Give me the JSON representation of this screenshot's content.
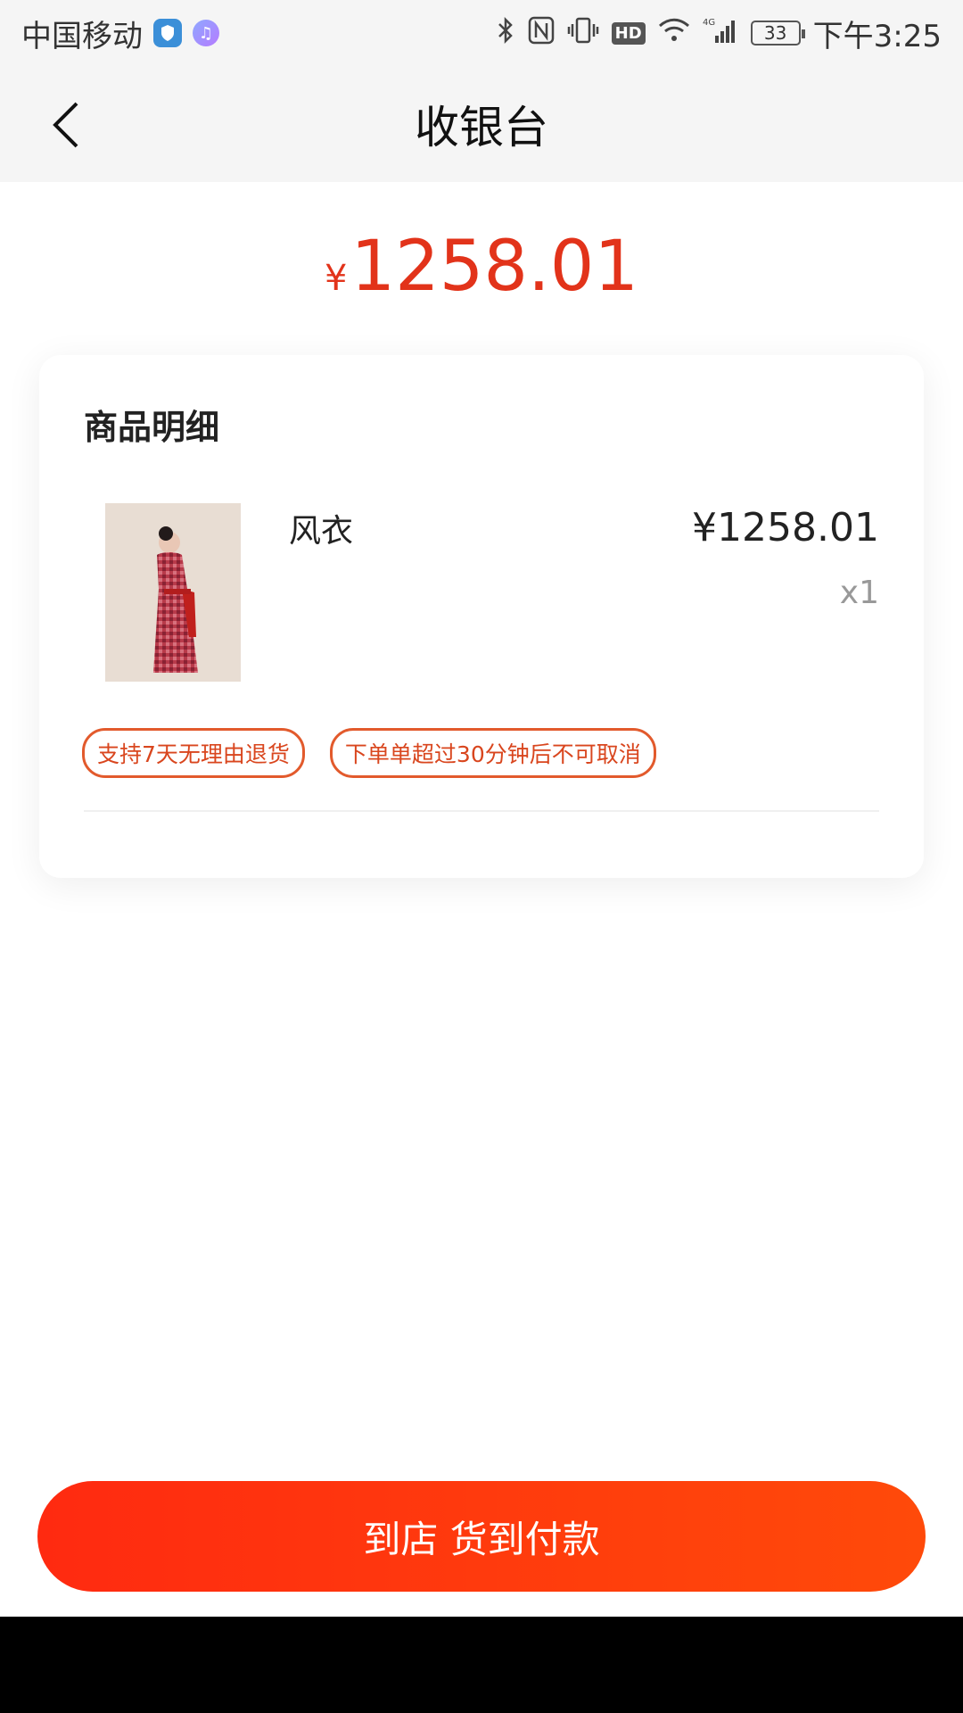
{
  "status_bar": {
    "carrier": "中国移动",
    "battery": "33",
    "time": "下午3:25",
    "network": "4G",
    "hd": "HD"
  },
  "nav": {
    "title": "收银台"
  },
  "amount": {
    "symbol": "¥",
    "value": "1258.01"
  },
  "card": {
    "title": "商品明细",
    "product": {
      "name": "风衣",
      "price": "¥1258.01",
      "qty": "x1"
    },
    "tags": [
      "支持7天无理由退货",
      "下单单超过30分钟后不可取消"
    ]
  },
  "pay_button": {
    "label": "到店 货到付款"
  },
  "colors": {
    "accent": "#e2331a",
    "button": "#ff2a10",
    "tag": "#e25a2c"
  }
}
